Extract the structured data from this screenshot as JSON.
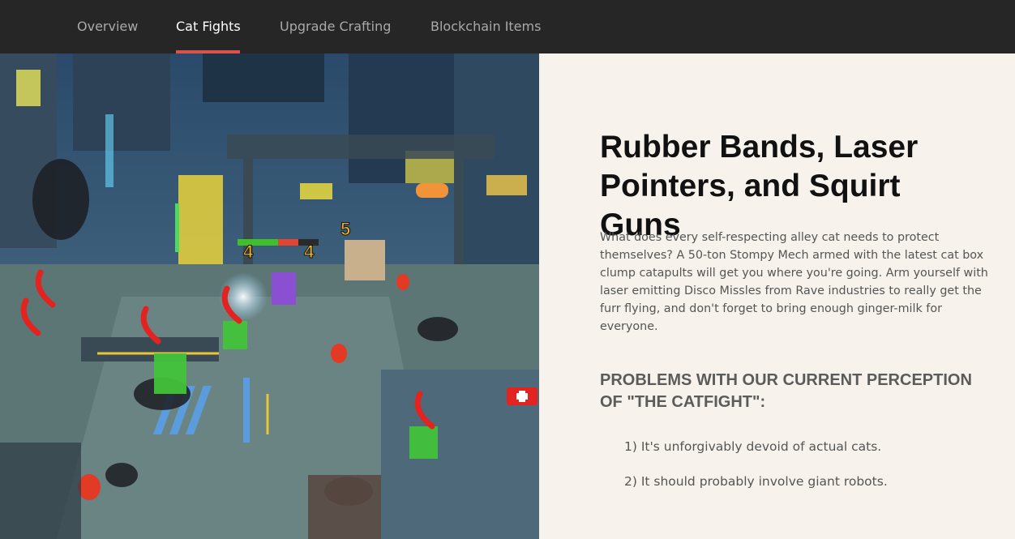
{
  "nav": {
    "tabs": [
      {
        "label": "Overview",
        "active": false
      },
      {
        "label": "Cat Fights",
        "active": true
      },
      {
        "label": "Upgrade Crafting",
        "active": false
      },
      {
        "label": "Blockchain Items",
        "active": false
      }
    ],
    "active_color": "#d9534a"
  },
  "hero": {
    "hud": {
      "left_value": "4",
      "right_value": "4",
      "wave_number": "5"
    },
    "colors": {
      "health_green": "#3fbf2a",
      "health_red": "#e0452f",
      "hud_yellow": "#f2b31c",
      "phone_red": "#e3231f"
    }
  },
  "content": {
    "heading": "Rubber Bands, Laser Pointers, and Squirt Guns",
    "intro": "What does every self-respecting alley cat needs to protect themselves? A 50-ton Stompy Mech armed with the latest cat box clump catapults will get you where you're going. Arm yourself with laser emitting Disco Missles from Rave industries to really get the furr flying, and don't forget to bring enough ginger-milk for everyone.",
    "subheading": "PROBLEMS WITH OUR CURRENT PERCEPTION OF \"THE CATFIGHT\":",
    "problems": [
      "1) It's unforgivably devoid of actual cats.",
      "2) It should probably involve giant robots."
    ]
  }
}
